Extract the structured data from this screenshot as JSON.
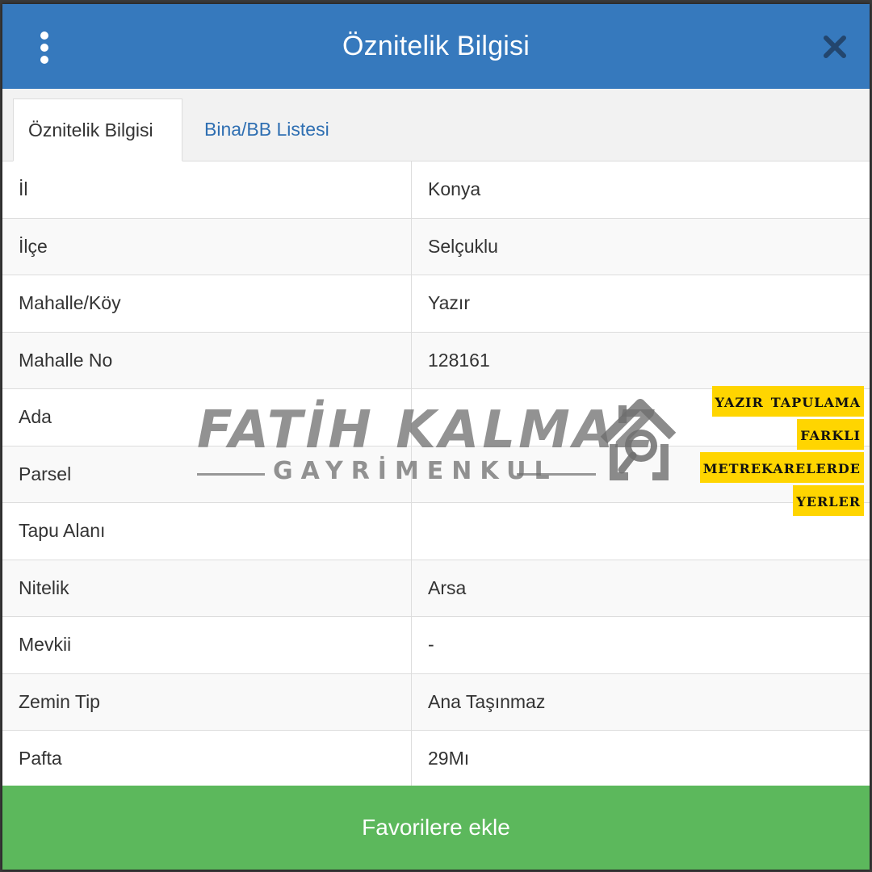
{
  "header": {
    "title": "Öznitelik Bilgisi",
    "menu_icon": "kebab-menu-icon",
    "close_icon": "close-icon"
  },
  "tabs": [
    {
      "label": "Öznitelik Bilgisi",
      "active": true
    },
    {
      "label": "Bina/BB Listesi",
      "active": false
    }
  ],
  "rows": [
    {
      "key": "İl",
      "value": "Konya"
    },
    {
      "key": "İlçe",
      "value": "Selçuklu"
    },
    {
      "key": "Mahalle/Köy",
      "value": "Yazır"
    },
    {
      "key": "Mahalle No",
      "value": "128161"
    },
    {
      "key": "Ada",
      "value": ""
    },
    {
      "key": "Parsel",
      "value": ""
    },
    {
      "key": "Tapu Alanı",
      "value": ""
    },
    {
      "key": "Nitelik",
      "value": "Arsa"
    },
    {
      "key": "Mevkii",
      "value": "-"
    },
    {
      "key": "Zemin Tip",
      "value": "Ana Taşınmaz"
    },
    {
      "key": "Pafta",
      "value": "29Mı"
    }
  ],
  "footer": {
    "button_label": "Favorilere ekle"
  },
  "watermark": {
    "main": "FATİH KALMAZ",
    "sub": "GAYRİMENKUL"
  },
  "promo": {
    "lines": [
      "yazır tapulama",
      "farklı",
      "metrekarelerde",
      "yerler"
    ]
  },
  "colors": {
    "header": "#3679bd",
    "footer": "#5cb85c",
    "tab_link": "#2f6fb2",
    "promo_bg": "#ffd500"
  }
}
